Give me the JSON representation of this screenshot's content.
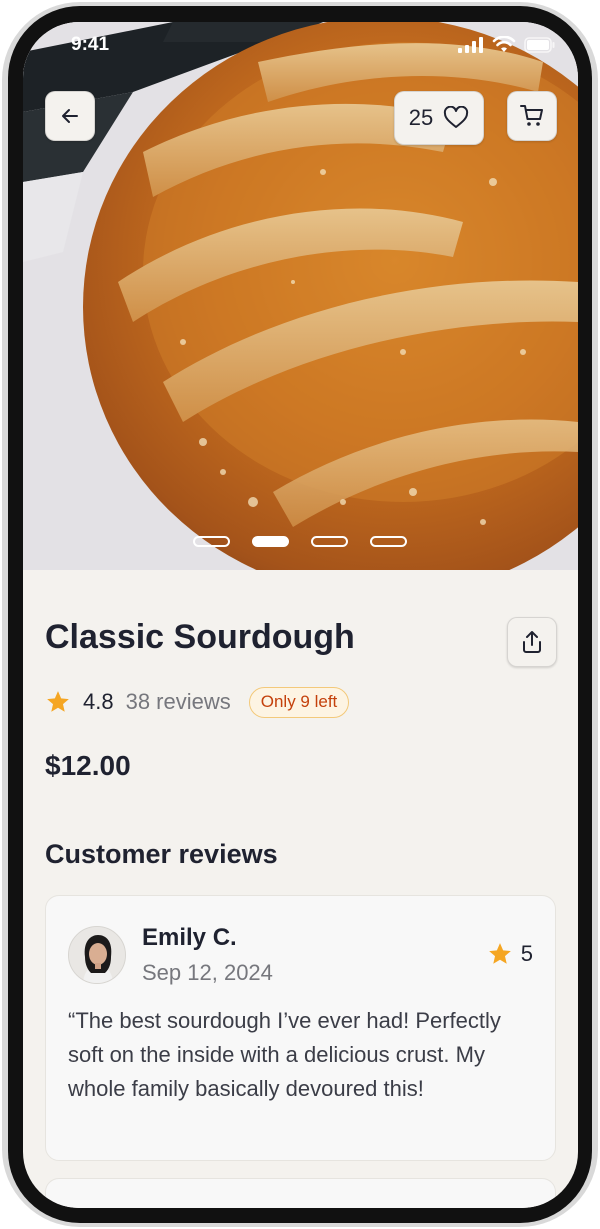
{
  "status_bar": {
    "time": "9:41"
  },
  "header": {
    "like_count": "25"
  },
  "carousel": {
    "slides": 4,
    "active_index": 1
  },
  "product": {
    "title": "Classic Sourdough",
    "rating": "4.8",
    "reviews_label": "38 reviews",
    "stock_badge": "Only 9 left",
    "price": "$12.00"
  },
  "reviews": {
    "section_title": "Customer reviews",
    "items": [
      {
        "name": "Emily C.",
        "date": "Sep 12, 2024",
        "rating": "5",
        "text": "“The best sourdough I’ve ever had! Perfectly soft on the inside with a delicious crust. My whole family basically devoured this!"
      }
    ]
  },
  "colors": {
    "background": "#f4f2ee",
    "text_primary": "#1f2230",
    "text_secondary": "#76777d",
    "star": "#f5a623",
    "badge_text": "#c4410c",
    "badge_border": "#f3c97a"
  },
  "icons": {
    "back": "arrow-left-icon",
    "like": "heart-icon",
    "cart": "cart-icon",
    "share": "share-icon",
    "star": "star-icon"
  }
}
